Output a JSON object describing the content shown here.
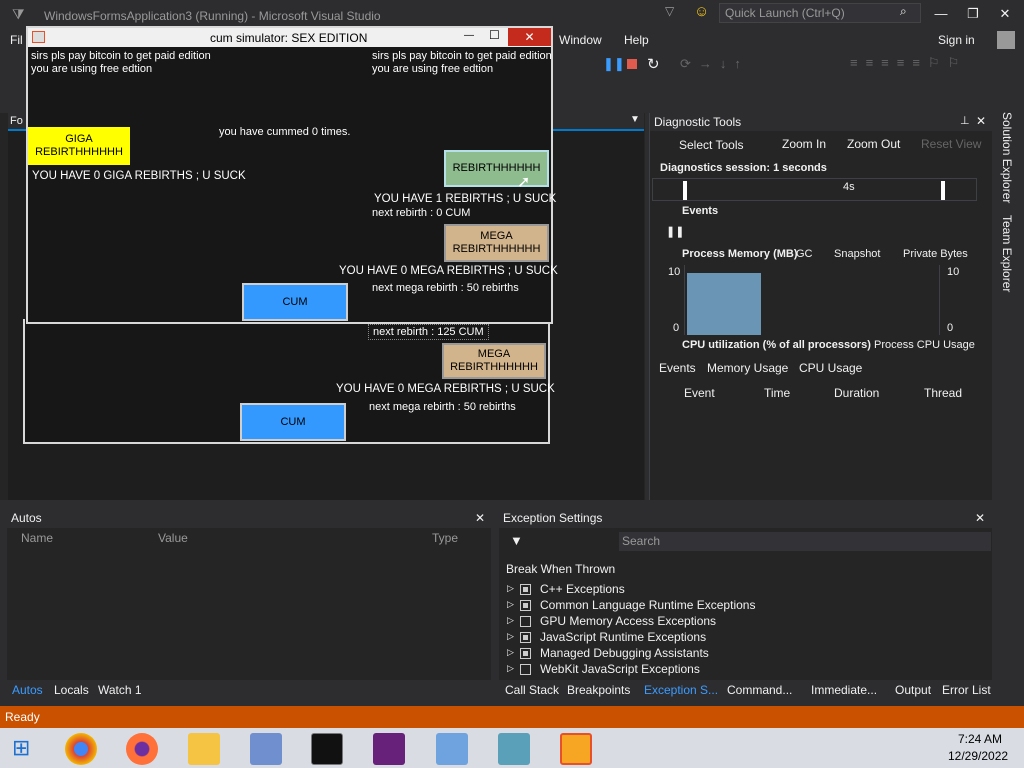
{
  "vs": {
    "title": "WindowsFormsApplication3 (Running) - Microsoft Visual Studio",
    "quick_launch_placeholder": "Quick Launch (Ctrl+Q)",
    "menu": [
      "Fil",
      "Window",
      "Help"
    ],
    "sign_in": "Sign in",
    "editor_tab_partial": "Fo"
  },
  "form": {
    "title": "cum simulator: SEX EDITION",
    "close_glyph": "✕",
    "min_glyph": "—",
    "max_glyph": "☐",
    "promo_left_1": "sirs pls pay bitcoin to  get paid edition",
    "promo_left_2": "you are using free edtion",
    "promo_right_1": "sirs pls pay bitcoin to  get paid edition",
    "promo_right_2": "you are using free edtion",
    "giga_button": "GIGA REBIRTHHHHHH",
    "cum_count": "you have cummed 0 times.",
    "rebirth_button": "REBIRTHHHHHH",
    "giga_count": "YOU HAVE  0 GIGA REBIRTHS ; U SUCK",
    "rebirth_count": "YOU HAVE  1 REBIRTHS ; U SUCK",
    "next_rebirth": "next rebirth : 0 CUM",
    "mega_button": "MEGA REBIRTHHHHHH",
    "mega_count": "YOU HAVE  0 MEGA REBIRTHS ; U SUCK",
    "next_mega": "next mega rebirth : 50 rebirths",
    "cum_button": "CUM"
  },
  "form_back": {
    "next_rebirth": "next rebirth : 125 CUM",
    "mega_button": "MEGA REBIRTHHHHHH",
    "mega_count": "YOU HAVE  0 MEGA REBIRTHS ; U SUCK",
    "next_mega": "next mega rebirth : 50 rebirths",
    "cum_button": "CUM"
  },
  "diag": {
    "title": "Diagnostic Tools",
    "select_tools": "Select Tools",
    "zoom_in": "Zoom In",
    "zoom_out": "Zoom Out",
    "reset_view": "Reset View",
    "session": "Diagnostics session: 1 seconds",
    "timeline_tick": "4s",
    "events_label": "Events",
    "process_memory": "Process Memory (MB)",
    "gc": "GC",
    "snapshot": "Snapshot",
    "private_bytes": "Private Bytes",
    "mem_max_left": "10",
    "mem_min_left": "0",
    "mem_max_right": "10",
    "mem_min_right": "0",
    "cpu": "CPU utilization (% of all processors)",
    "cpu_legend": "Process CPU Usage",
    "tabs": [
      "Events",
      "Memory Usage",
      "CPU Usage"
    ],
    "columns": [
      "Event",
      "Time",
      "Duration",
      "Thread"
    ]
  },
  "side_tabs": [
    "Solution Explorer",
    "Team Explorer"
  ],
  "autos": {
    "title": "Autos",
    "columns": [
      "Name",
      "Value",
      "Type"
    ],
    "tabs": [
      "Autos",
      "Locals",
      "Watch 1"
    ]
  },
  "exceptions": {
    "title": "Exception Settings",
    "search_placeholder": "Search",
    "header": "Break When Thrown",
    "items": [
      {
        "label": "C++ Exceptions",
        "checked": true
      },
      {
        "label": "Common Language Runtime Exceptions",
        "checked": true
      },
      {
        "label": "GPU Memory Access Exceptions",
        "checked": false
      },
      {
        "label": "JavaScript Runtime Exceptions",
        "checked": true
      },
      {
        "label": "Managed Debugging Assistants",
        "checked": true
      },
      {
        "label": "WebKit JavaScript Exceptions",
        "checked": false
      }
    ],
    "tabs": [
      "Call Stack",
      "Breakpoints",
      "Exception S...",
      "Command...",
      "Immediate...",
      "Output",
      "Error List"
    ]
  },
  "status": {
    "text": "Ready"
  },
  "clock": {
    "time": "7:24 AM",
    "date": "12/29/2022"
  },
  "colors": {
    "accent": "#007acc",
    "status": "#ca5100",
    "giga": "#ffff00",
    "rebirth": "#8fbc8f",
    "mega": "#d2b48c",
    "cum": "#3399ff"
  }
}
